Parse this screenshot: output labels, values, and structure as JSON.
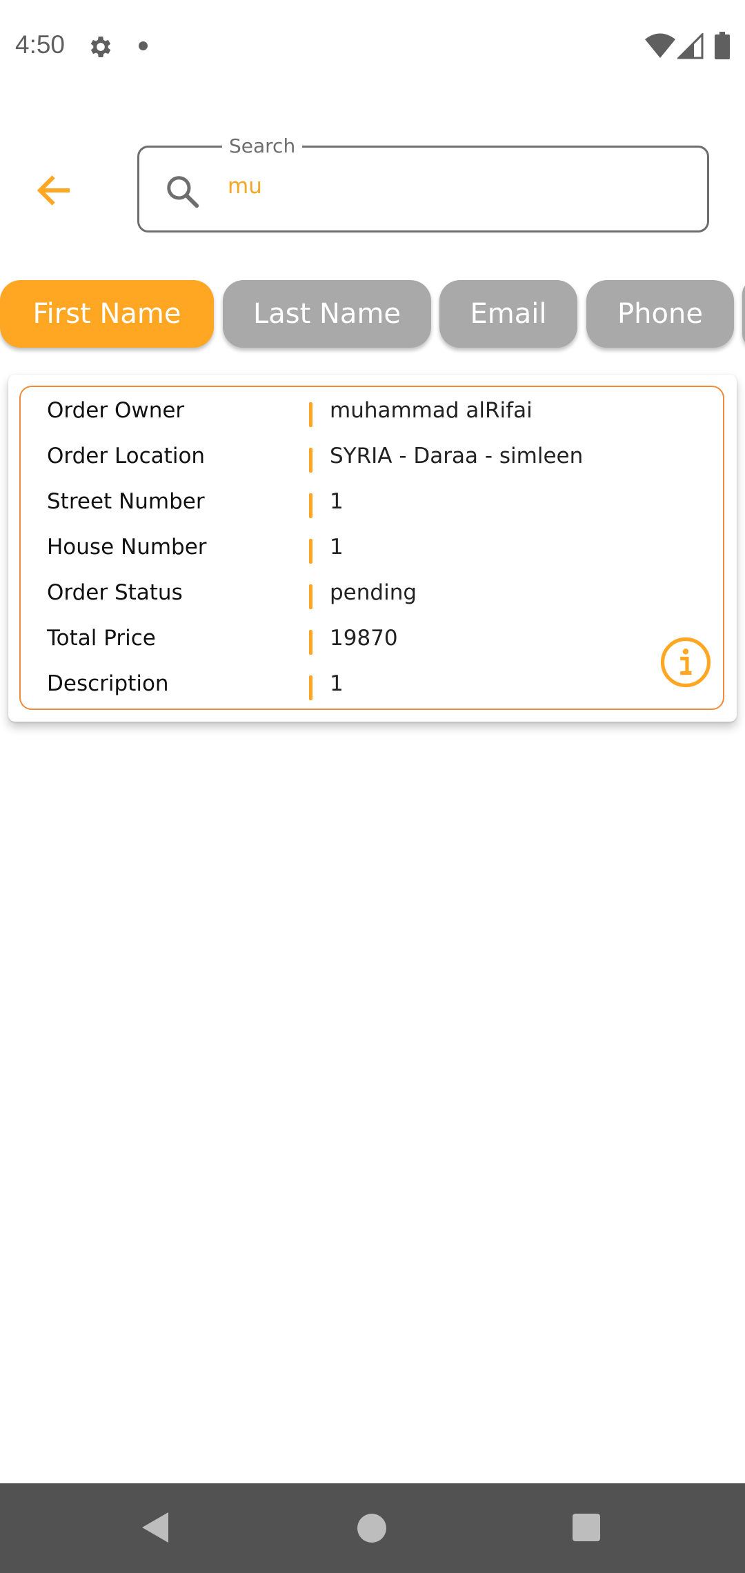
{
  "status_bar": {
    "time": "4:50",
    "icons": [
      "gear-icon",
      "notification-dot-icon",
      "wifi-icon",
      "cellular-signal-icon",
      "battery-icon"
    ]
  },
  "header": {
    "back_icon": "arrow-left-icon",
    "search": {
      "label": "Search",
      "value": "mu",
      "icon": "search-icon"
    }
  },
  "filters": [
    {
      "label": "First Name",
      "active": true
    },
    {
      "label": "Last Name",
      "active": false
    },
    {
      "label": "Email",
      "active": false
    },
    {
      "label": "Phone",
      "active": false
    }
  ],
  "order": {
    "fields": [
      {
        "key": "Order Owner",
        "value": "muhammad alRifai"
      },
      {
        "key": "Order Location",
        "value": "SYRIA - Daraa - simleen"
      },
      {
        "key": "Street Number",
        "value": "1"
      },
      {
        "key": "House Number",
        "value": "1"
      },
      {
        "key": "Order Status",
        "value": "pending"
      },
      {
        "key": "Total Price",
        "value": "19870"
      },
      {
        "key": "Description",
        "value": "1"
      }
    ],
    "info_icon": "info-circle-icon"
  },
  "colors": {
    "accent": "#ffa722",
    "chip_inactive": "#a9a9a9",
    "card_border": "#f08a3a",
    "nav_bar": "#525252"
  },
  "nav_bar": {
    "icons": [
      "nav-back-icon",
      "nav-home-icon",
      "nav-recents-icon"
    ]
  }
}
